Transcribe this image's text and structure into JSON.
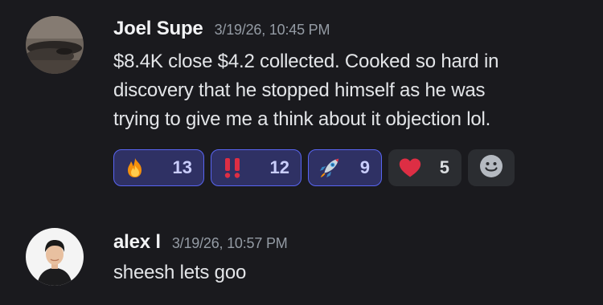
{
  "messages": [
    {
      "author": "Joel Supe",
      "timestamp": "3/19/26, 10:45 PM",
      "lines": [
        "$8.4K close $4.2 collected. Cooked so hard in",
        "discovery that he stopped himself as he was",
        "trying to give me a think about it objection lol."
      ],
      "reactions": [
        {
          "emoji": "fire-icon",
          "count": "13",
          "me": true
        },
        {
          "emoji": "double-exclamation-icon",
          "count": "12",
          "me": true
        },
        {
          "emoji": "rocket-icon",
          "count": "9",
          "me": true
        },
        {
          "emoji": "heart-icon",
          "count": "5",
          "me": false
        }
      ],
      "add_reaction_icon": "add-reaction-smiley-icon"
    },
    {
      "author": "alex l",
      "timestamp": "3/19/26, 10:57 PM",
      "lines": [
        "sheesh lets goo"
      ]
    }
  ],
  "colors": {
    "background": "#1a1a1e",
    "author": "#f2f3f5",
    "timestamp": "#949ba4",
    "reaction_active_bg": "#2f3164",
    "reaction_active_border": "#5865f2",
    "reaction_bg": "#2b2d31"
  }
}
